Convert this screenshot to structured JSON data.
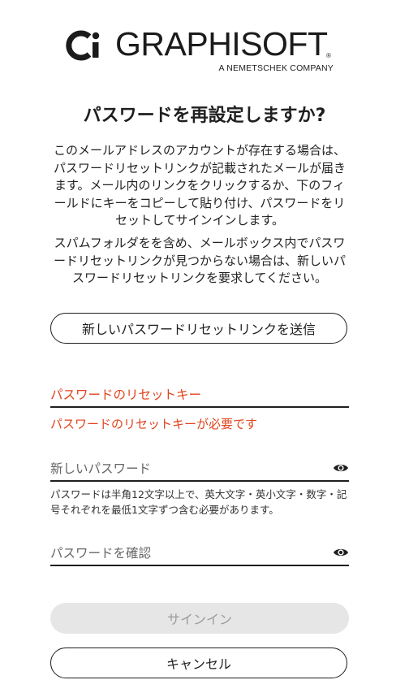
{
  "brand": {
    "name": "GRAPHISOFT",
    "registered": "®",
    "tagline": "A NEMETSCHEK COMPANY"
  },
  "heading": "パスワードを再設定しますか?",
  "info_paragraphs": [
    "このメールアドレスのアカウントが存在する場合は、パスワードリセットリンクが記載されたメールが届きます。メール内のリンクをクリックするか、下のフィールドにキーをコピーして貼り付け、パスワードをリセットしてサインインします。",
    "スパムフォルダをを含め、メールボックス内でパスワードリセットリンクが見つからない場合は、新しいパスワードリセットリンクを要求してください。"
  ],
  "buttons": {
    "send_new_link": "新しいパスワードリセットリンクを送信",
    "sign_in": "サインイン",
    "cancel": "キャンセル"
  },
  "fields": {
    "reset_key": {
      "label": "パスワードのリセットキー",
      "error": "パスワードのリセットキーが必要です"
    },
    "new_password": {
      "placeholder": "新しいパスワード",
      "hint": "パスワードは半角12文字以上で、英大文字・英小文字・数字・記号それぞれを最低1文字ずつ含む必要があります。"
    },
    "confirm_password": {
      "placeholder": "パスワードを確認"
    }
  },
  "icons": {
    "eye": "eye-icon",
    "logo_mark": "graphisoft-logo-mark"
  },
  "colors": {
    "error": "#e0431d",
    "text": "#1f1f1f",
    "disabled_bg": "#e6e6e6",
    "disabled_text": "#9a9a9a"
  }
}
